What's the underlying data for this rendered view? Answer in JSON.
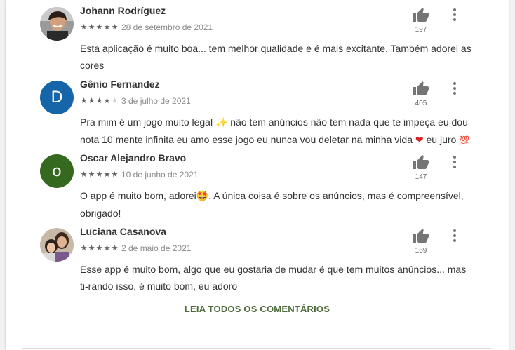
{
  "reviews": [
    {
      "name": "Johann Rodríguez",
      "rating": 5,
      "date": "28 de setembro de 2021",
      "text": "Esta aplicação é muito boa... tem melhor qualidade e é mais excitante. Também adorei as cores",
      "likes": "197",
      "avatar": {
        "type": "photo",
        "bg": "#8d8d8d"
      }
    },
    {
      "name": "Gênio Fernandez",
      "rating": 4,
      "date": "3 de julho de 2021",
      "text_parts": [
        "Pra mim é um jogo muito legal ",
        "✨",
        " não tem anúncios não tem nada que te impeça eu dou nota 10 mente infinita eu amo esse jogo eu nunca vou deletar na minha vida ",
        "❤",
        " eu juro ",
        "💯"
      ],
      "likes": "405",
      "avatar": {
        "type": "letter",
        "letter": "D",
        "bg": "#1565a8"
      }
    },
    {
      "name": "Oscar Alejandro Bravo",
      "rating": 5,
      "date": "10 de junho de 2021",
      "text_parts": [
        "O app é muito bom, adorei",
        "🤩",
        ". A única coisa é sobre os anúncios, mas é compreensível, obrigado!"
      ],
      "likes": "147",
      "avatar": {
        "type": "letter",
        "letter": "o",
        "bg": "#34691f"
      }
    },
    {
      "name": "Luciana Casanova",
      "rating": 5,
      "date": "2 de maio de 2021",
      "text": "Esse app é muito bom, algo que eu gostaria de mudar é que tem muitos anúncios... mas ti-rando isso, é muito bom, eu adoro",
      "likes": "169",
      "avatar": {
        "type": "photo",
        "bg": "#b7a48f"
      }
    }
  ],
  "read_all_label": "LEIA TODOS OS COMENTÁRIOS",
  "colors": {
    "accent": "#4e6c3c",
    "star": "#616161",
    "star_empty": "#cfcfcf",
    "icon": "#757575"
  },
  "icons": {
    "like": "thumb-up-icon",
    "menu": "more-vert-icon",
    "star": "star-icon"
  }
}
